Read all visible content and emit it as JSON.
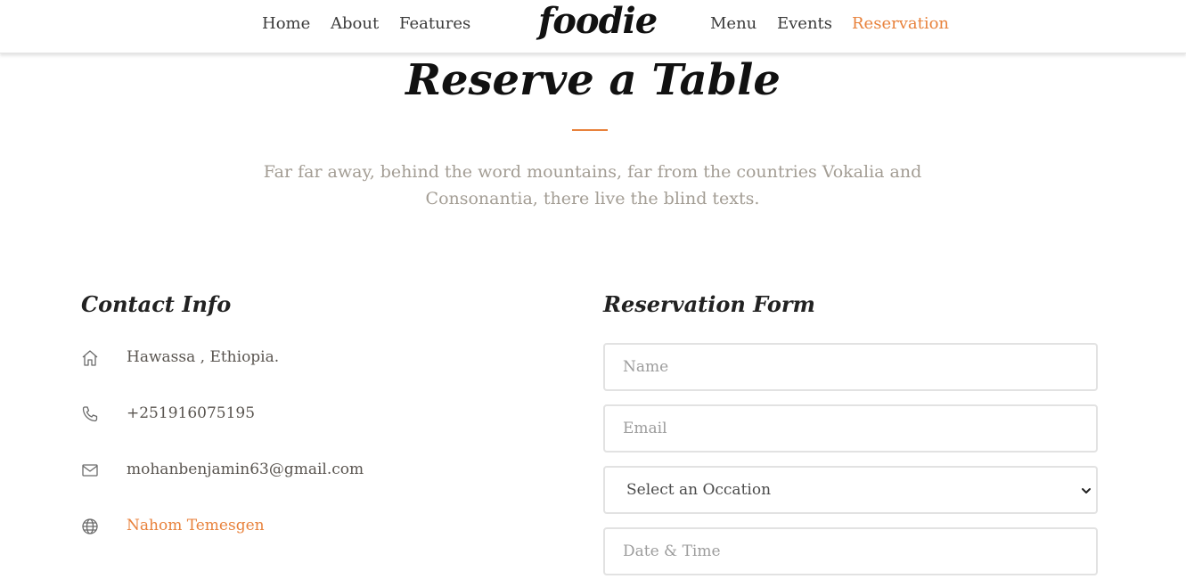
{
  "nav": {
    "left_links": [
      "Home",
      "About",
      "Features"
    ],
    "brand": "foodie",
    "right_links": [
      "Menu",
      "Events",
      "Reservation"
    ],
    "active": "Reservation"
  },
  "hero": {
    "title": "Reserve a Table",
    "subtitle_line1": "Far far away, behind the word mountains, far from the countries Vokalia and",
    "subtitle_line2": "Consonantia, there live the blind texts."
  },
  "contact": {
    "heading": "Contact Info",
    "items": [
      {
        "icon": "home-icon",
        "text": "Hawassa , Ethiopia."
      },
      {
        "icon": "phone-icon",
        "text": "+251916075195"
      },
      {
        "icon": "mail-icon",
        "text": "mohanbenjamin63@gmail.com"
      },
      {
        "icon": "globe-icon",
        "text": "Nahom Temesgen"
      }
    ]
  },
  "form": {
    "heading": "Reservation Form",
    "name_placeholder": "Name",
    "email_placeholder": "Email",
    "occasion_selected": "Select an Occation",
    "datetime_placeholder": "Date & Time"
  },
  "colors": {
    "accent": "#e8823c",
    "subtitle": "#a39d94",
    "text": "#4a4a4a",
    "border": "#e2e2e2"
  }
}
